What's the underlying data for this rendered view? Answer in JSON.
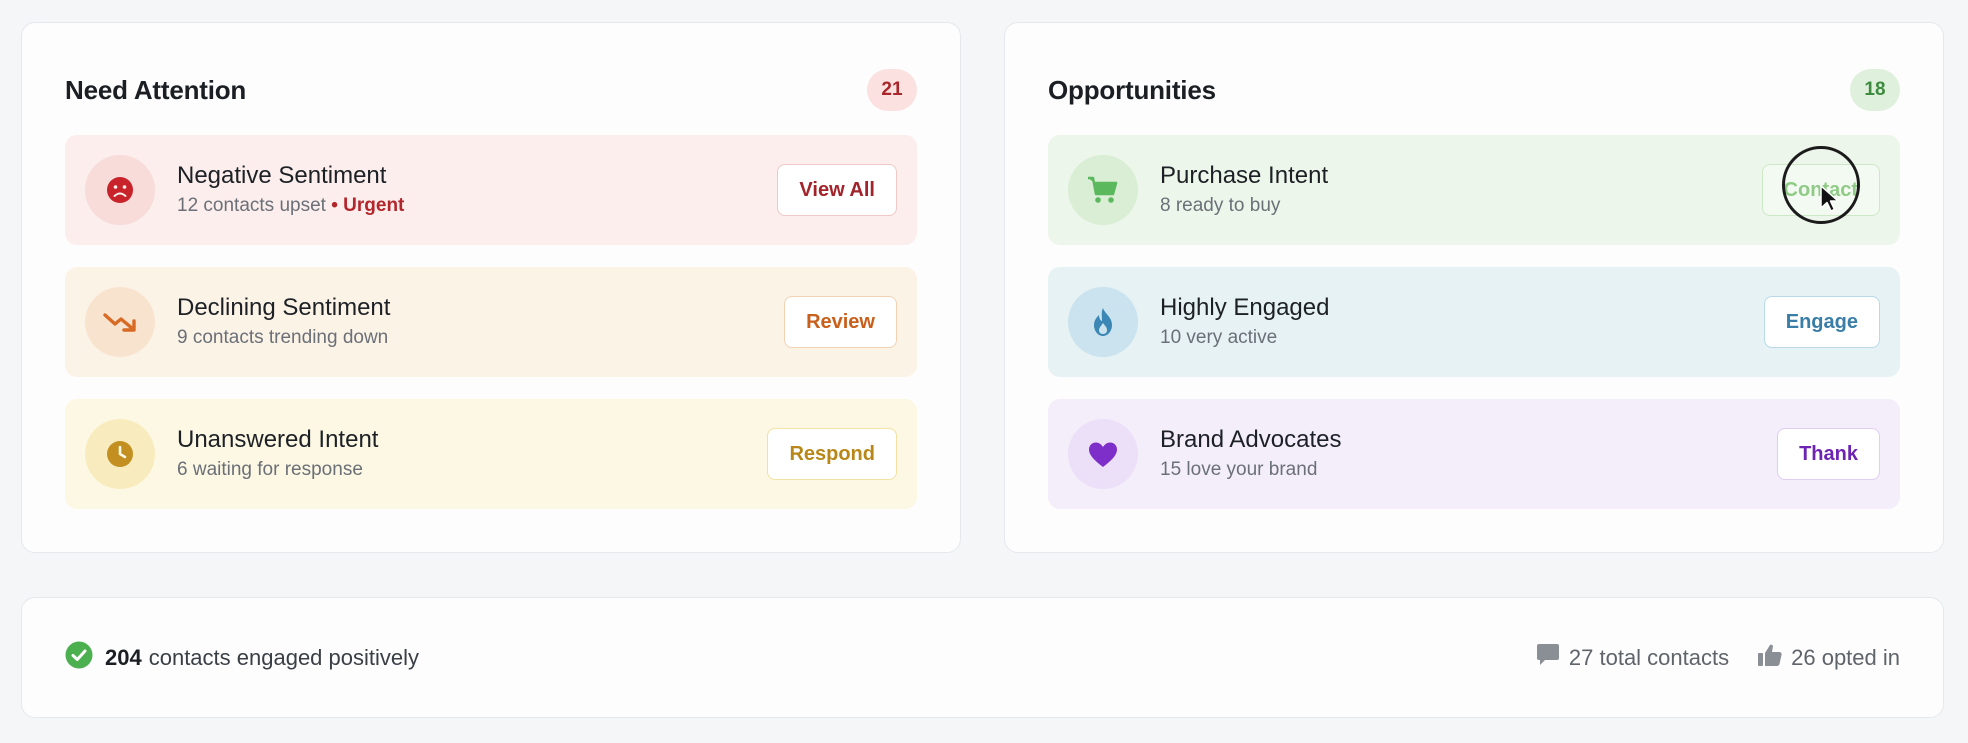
{
  "attention": {
    "title": "Need Attention",
    "count": "21",
    "rows": [
      {
        "title": "Negative Sentiment",
        "subtitle": "12 contacts upset",
        "flag": "• Urgent",
        "action": "View All"
      },
      {
        "title": "Declining Sentiment",
        "subtitle": "9 contacts trending down",
        "action": "Review"
      },
      {
        "title": "Unanswered Intent",
        "subtitle": "6 waiting for response",
        "action": "Respond"
      }
    ]
  },
  "opportunities": {
    "title": "Opportunities",
    "count": "18",
    "rows": [
      {
        "title": "Purchase Intent",
        "subtitle": "8 ready to buy",
        "action": "Contact"
      },
      {
        "title": "Highly Engaged",
        "subtitle": "10 very active",
        "action": "Engage"
      },
      {
        "title": "Brand Advocates",
        "subtitle": "15 love your brand",
        "action": "Thank"
      }
    ]
  },
  "footer": {
    "engaged_count": "204",
    "engaged_label": "contacts engaged positively",
    "total_contacts": "27 total contacts",
    "opted_in": "26 opted in"
  },
  "icons": {
    "negative": "frown-icon",
    "declining": "trending-down-icon",
    "unanswered": "clock-icon",
    "purchase": "cart-icon",
    "engaged": "flame-icon",
    "advocates": "heart-icon",
    "check": "check-circle-icon",
    "comment": "comment-icon",
    "thumb": "thumbs-up-icon"
  },
  "colors": {
    "danger": "#b3262c",
    "warning": "#d9772b",
    "caution": "#c79a23",
    "success": "#4caf50",
    "info": "#3b87b5",
    "purple": "#7e2ec9"
  }
}
